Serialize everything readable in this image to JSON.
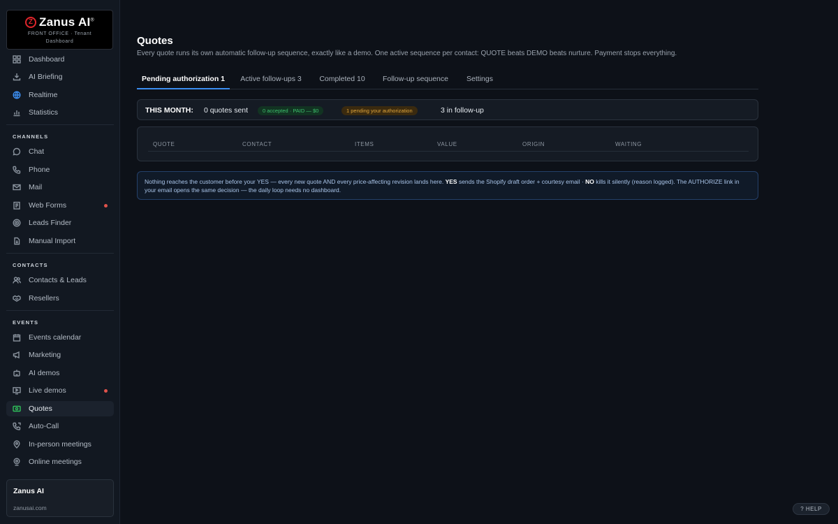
{
  "brand": {
    "logo_letter": "Z",
    "name": "Zanus AI",
    "mark": "®",
    "subtitle_line1": "FRONT OFFICE · Tenant",
    "subtitle_line2": "Dashboard"
  },
  "sidebar": {
    "top_items": [
      {
        "label": "Dashboard",
        "icon": "grid-icon"
      },
      {
        "label": "AI Briefing",
        "icon": "download-icon"
      },
      {
        "label": "Realtime",
        "icon": "globe-icon"
      },
      {
        "label": "Statistics",
        "icon": "bar-chart-icon"
      }
    ],
    "sections": {
      "channels": "CHANNELS",
      "contacts": "CONTACTS",
      "events": "EVENTS"
    },
    "channels": [
      {
        "label": "Chat",
        "icon": "chat-icon"
      },
      {
        "label": "Phone",
        "icon": "phone-icon"
      },
      {
        "label": "Mail",
        "icon": "mail-icon"
      },
      {
        "label": "Web Forms",
        "icon": "form-icon"
      },
      {
        "label": "Leads Finder",
        "icon": "radar-icon"
      },
      {
        "label": "Manual Import",
        "icon": "file-import-icon"
      }
    ],
    "contacts": [
      {
        "label": "Contacts & Leads",
        "icon": "users-icon"
      },
      {
        "label": "Resellers",
        "icon": "handshake-icon"
      }
    ],
    "events": [
      {
        "label": "Events calendar",
        "icon": "calendar-icon"
      },
      {
        "label": "Marketing",
        "icon": "megaphone-icon"
      },
      {
        "label": "AI demos",
        "icon": "robot-icon"
      },
      {
        "label": "Live demos",
        "icon": "monitor-play-icon"
      },
      {
        "label": "Quotes",
        "icon": "quote-icon"
      },
      {
        "label": "Auto-Call",
        "icon": "auto-call-icon"
      },
      {
        "label": "In-person meetings",
        "icon": "location-icon"
      },
      {
        "label": "Online meetings",
        "icon": "webcam-icon"
      }
    ],
    "tenant": {
      "name": "Zanus AI",
      "domain": "zanusai.com"
    }
  },
  "main": {
    "title": "Quotes",
    "subtitle": "Every quote runs its own automatic follow-up sequence, exactly like a demo. One active sequence per contact: QUOTE beats DEMO beats nurture. Payment stops everything.",
    "tabs": [
      {
        "label": "Pending authorization 1"
      },
      {
        "label": "Active follow-ups 3"
      },
      {
        "label": "Completed 10"
      },
      {
        "label": "Follow-up sequence"
      },
      {
        "label": "Settings"
      }
    ],
    "month": {
      "label": "THIS MONTH:",
      "sent": "0 quotes sent",
      "accepted_badge": "0 accepted · PAID — $0",
      "pending_badge": "1 pending your authorization",
      "follow_up": "3 in follow-up"
    },
    "table_headers": [
      "QUOTE",
      "CONTACT",
      "ITEMS",
      "VALUE",
      "ORIGIN",
      "WAITING"
    ],
    "info": {
      "part1": "Nothing reaches the customer before your YES — every new quote AND every price-affecting revision lands here. ",
      "yes": "YES",
      "part2": " sends the Shopify draft order + courtesy email · ",
      "no": "NO",
      "part3": " kills it silently (reason logged). The AUTHORIZE link in your email opens the same decision — the daily loop needs no dashboard."
    },
    "help_label": "? HELP"
  },
  "colors": {
    "accent": "#3b8df0",
    "active_icon": "#2fbf5a",
    "badge_green": "#3ec06d",
    "badge_amber": "#e0a63b",
    "notification_dot": "#e0524b"
  }
}
